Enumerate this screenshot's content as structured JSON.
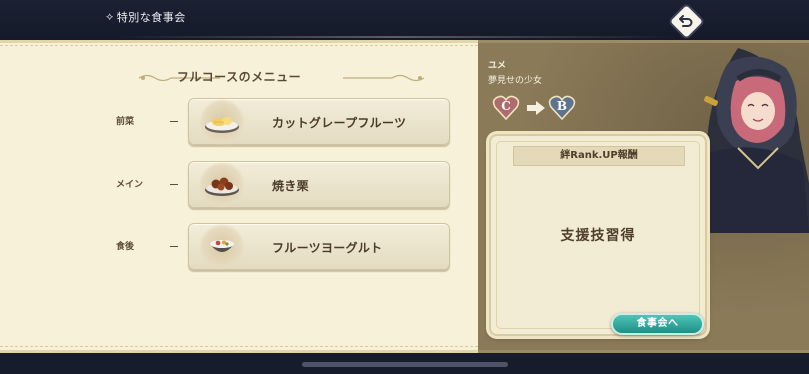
{
  "header": {
    "title": "特別な食事会",
    "title_icon": "⟡",
    "back_icon": "return-arrow"
  },
  "menu": {
    "heading": "フルコースのメニュー",
    "courses": [
      {
        "label": "前菜",
        "dish": "カットグレープフルーツ",
        "icon": "grapefruit-plate"
      },
      {
        "label": "メイン",
        "dish": "焼き栗",
        "icon": "roasted-chestnuts"
      },
      {
        "label": "食後",
        "dish": "フルーツヨーグルト",
        "icon": "fruit-yogurt-bowl"
      }
    ]
  },
  "character": {
    "name": "ユメ",
    "title": "夢見せの少女",
    "rank_from": "C",
    "rank_to": "B"
  },
  "reward": {
    "header": "絆Rank.UP報酬",
    "text": "支援技習得"
  },
  "action": {
    "button_label": "食事会へ"
  },
  "colors": {
    "panel_cream": "#f7f1da",
    "panel_tan": "#8a7a58",
    "button_teal": "#2aa396",
    "text_brown": "#4b3b29"
  }
}
